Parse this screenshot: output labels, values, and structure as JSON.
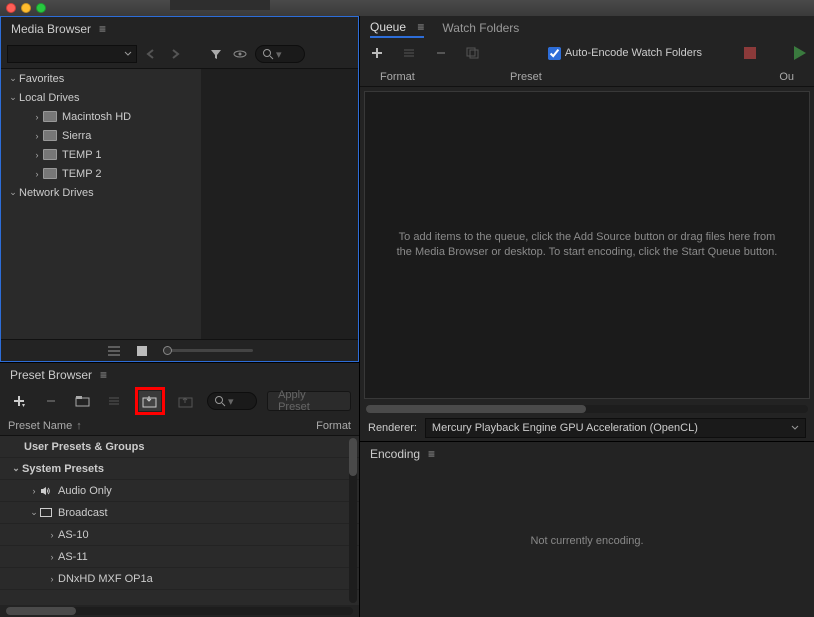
{
  "panels": {
    "mediaBrowser": {
      "title": "Media Browser"
    },
    "presetBrowser": {
      "title": "Preset Browser"
    },
    "queue": {
      "title": "Queue"
    },
    "watchFolders": {
      "title": "Watch Folders"
    },
    "encoding": {
      "title": "Encoding"
    }
  },
  "mediaBrowser": {
    "tree": {
      "favorites": "Favorites",
      "localDrives": "Local Drives",
      "drives": [
        "Macintosh HD",
        "Sierra",
        "TEMP 1",
        "TEMP 2"
      ],
      "networkDrives": "Network Drives"
    }
  },
  "presetBrowser": {
    "applyLabel": "Apply Preset",
    "columns": {
      "name": "Preset Name",
      "format": "Format"
    },
    "rows": {
      "userPresets": "User Presets & Groups",
      "systemPresets": "System Presets",
      "audioOnly": "Audio Only",
      "broadcast": "Broadcast",
      "as10": "AS-10",
      "as11": "AS-11",
      "dnxhd": "DNxHD MXF OP1a"
    }
  },
  "queue": {
    "autoEncodeLabel": "Auto-Encode Watch Folders",
    "autoEncodeChecked": true,
    "columns": {
      "format": "Format",
      "preset": "Preset",
      "output": "Ou"
    },
    "emptyMessage": "To add items to the queue, click the Add Source button or drag files here from the Media Browser or desktop.  To start encoding, click the Start Queue button."
  },
  "renderer": {
    "label": "Renderer:",
    "value": "Mercury Playback Engine GPU Acceleration (OpenCL)"
  },
  "encoding": {
    "message": "Not currently encoding."
  }
}
